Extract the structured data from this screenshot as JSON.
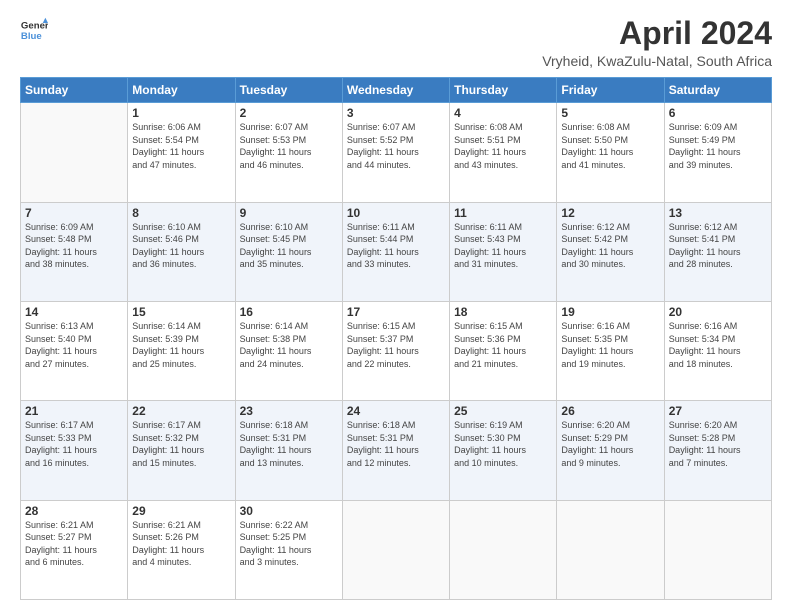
{
  "logo": {
    "line1": "General",
    "line2": "Blue"
  },
  "title": "April 2024",
  "subtitle": "Vryheid, KwaZulu-Natal, South Africa",
  "days_of_week": [
    "Sunday",
    "Monday",
    "Tuesday",
    "Wednesday",
    "Thursday",
    "Friday",
    "Saturday"
  ],
  "weeks": [
    [
      {
        "day": "",
        "info": ""
      },
      {
        "day": "1",
        "info": "Sunrise: 6:06 AM\nSunset: 5:54 PM\nDaylight: 11 hours\nand 47 minutes."
      },
      {
        "day": "2",
        "info": "Sunrise: 6:07 AM\nSunset: 5:53 PM\nDaylight: 11 hours\nand 46 minutes."
      },
      {
        "day": "3",
        "info": "Sunrise: 6:07 AM\nSunset: 5:52 PM\nDaylight: 11 hours\nand 44 minutes."
      },
      {
        "day": "4",
        "info": "Sunrise: 6:08 AM\nSunset: 5:51 PM\nDaylight: 11 hours\nand 43 minutes."
      },
      {
        "day": "5",
        "info": "Sunrise: 6:08 AM\nSunset: 5:50 PM\nDaylight: 11 hours\nand 41 minutes."
      },
      {
        "day": "6",
        "info": "Sunrise: 6:09 AM\nSunset: 5:49 PM\nDaylight: 11 hours\nand 39 minutes."
      }
    ],
    [
      {
        "day": "7",
        "info": "Sunrise: 6:09 AM\nSunset: 5:48 PM\nDaylight: 11 hours\nand 38 minutes."
      },
      {
        "day": "8",
        "info": "Sunrise: 6:10 AM\nSunset: 5:46 PM\nDaylight: 11 hours\nand 36 minutes."
      },
      {
        "day": "9",
        "info": "Sunrise: 6:10 AM\nSunset: 5:45 PM\nDaylight: 11 hours\nand 35 minutes."
      },
      {
        "day": "10",
        "info": "Sunrise: 6:11 AM\nSunset: 5:44 PM\nDaylight: 11 hours\nand 33 minutes."
      },
      {
        "day": "11",
        "info": "Sunrise: 6:11 AM\nSunset: 5:43 PM\nDaylight: 11 hours\nand 31 minutes."
      },
      {
        "day": "12",
        "info": "Sunrise: 6:12 AM\nSunset: 5:42 PM\nDaylight: 11 hours\nand 30 minutes."
      },
      {
        "day": "13",
        "info": "Sunrise: 6:12 AM\nSunset: 5:41 PM\nDaylight: 11 hours\nand 28 minutes."
      }
    ],
    [
      {
        "day": "14",
        "info": "Sunrise: 6:13 AM\nSunset: 5:40 PM\nDaylight: 11 hours\nand 27 minutes."
      },
      {
        "day": "15",
        "info": "Sunrise: 6:14 AM\nSunset: 5:39 PM\nDaylight: 11 hours\nand 25 minutes."
      },
      {
        "day": "16",
        "info": "Sunrise: 6:14 AM\nSunset: 5:38 PM\nDaylight: 11 hours\nand 24 minutes."
      },
      {
        "day": "17",
        "info": "Sunrise: 6:15 AM\nSunset: 5:37 PM\nDaylight: 11 hours\nand 22 minutes."
      },
      {
        "day": "18",
        "info": "Sunrise: 6:15 AM\nSunset: 5:36 PM\nDaylight: 11 hours\nand 21 minutes."
      },
      {
        "day": "19",
        "info": "Sunrise: 6:16 AM\nSunset: 5:35 PM\nDaylight: 11 hours\nand 19 minutes."
      },
      {
        "day": "20",
        "info": "Sunrise: 6:16 AM\nSunset: 5:34 PM\nDaylight: 11 hours\nand 18 minutes."
      }
    ],
    [
      {
        "day": "21",
        "info": "Sunrise: 6:17 AM\nSunset: 5:33 PM\nDaylight: 11 hours\nand 16 minutes."
      },
      {
        "day": "22",
        "info": "Sunrise: 6:17 AM\nSunset: 5:32 PM\nDaylight: 11 hours\nand 15 minutes."
      },
      {
        "day": "23",
        "info": "Sunrise: 6:18 AM\nSunset: 5:31 PM\nDaylight: 11 hours\nand 13 minutes."
      },
      {
        "day": "24",
        "info": "Sunrise: 6:18 AM\nSunset: 5:31 PM\nDaylight: 11 hours\nand 12 minutes."
      },
      {
        "day": "25",
        "info": "Sunrise: 6:19 AM\nSunset: 5:30 PM\nDaylight: 11 hours\nand 10 minutes."
      },
      {
        "day": "26",
        "info": "Sunrise: 6:20 AM\nSunset: 5:29 PM\nDaylight: 11 hours\nand 9 minutes."
      },
      {
        "day": "27",
        "info": "Sunrise: 6:20 AM\nSunset: 5:28 PM\nDaylight: 11 hours\nand 7 minutes."
      }
    ],
    [
      {
        "day": "28",
        "info": "Sunrise: 6:21 AM\nSunset: 5:27 PM\nDaylight: 11 hours\nand 6 minutes."
      },
      {
        "day": "29",
        "info": "Sunrise: 6:21 AM\nSunset: 5:26 PM\nDaylight: 11 hours\nand 4 minutes."
      },
      {
        "day": "30",
        "info": "Sunrise: 6:22 AM\nSunset: 5:25 PM\nDaylight: 11 hours\nand 3 minutes."
      },
      {
        "day": "",
        "info": ""
      },
      {
        "day": "",
        "info": ""
      },
      {
        "day": "",
        "info": ""
      },
      {
        "day": "",
        "info": ""
      }
    ]
  ]
}
